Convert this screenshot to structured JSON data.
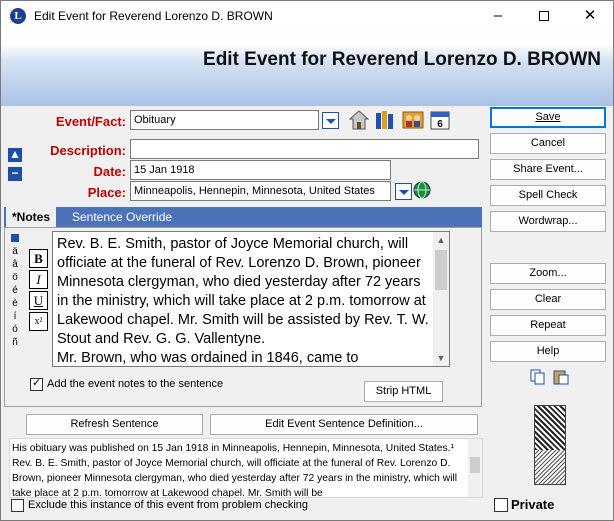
{
  "window": {
    "title": "Edit Event for Reverend Lorenzo D. BROWN",
    "app_icon": "L"
  },
  "header": {
    "title": "Edit Event for Reverend Lorenzo D. BROWN"
  },
  "form": {
    "event_fact": {
      "label": "Event/Fact:",
      "value": "Obituary"
    },
    "description": {
      "label": "Description:",
      "value": ""
    },
    "date": {
      "label": "Date:",
      "value": "15 Jan 1918"
    },
    "place": {
      "label": "Place:",
      "value": "Minneapolis, Hennepin, Minnesota, United States"
    }
  },
  "icons": {
    "house": "house-icon",
    "books": "books-icon",
    "people": "people-icon",
    "calendar": "calendar-icon",
    "calendar_text": "6",
    "globe": "globe-icon"
  },
  "tabs": [
    {
      "label": "*Notes"
    },
    {
      "label": "Sentence Override"
    }
  ],
  "special_chars": [
    "ä",
    "â",
    "ö",
    "é",
    "è",
    "í",
    "ó",
    "ñ"
  ],
  "format_buttons": {
    "bold": "B",
    "italic": "I",
    "underline": "U",
    "superscript": "x²"
  },
  "notes": {
    "text": "Rev. B. E. Smith, pastor of Joyce Memorial church, will officiate at the funeral of Rev. Lorenzo D. Brown, pioneer Minnesota clergyman, who died yesterday after 72 years in the ministry, which will take place at 2 p.m. tomorrow at Lakewood chapel.  Mr. Smith will be assisted by Rev. T. W. Stout and Rev. G. G. Vallentyne.\nMr. Brown, who was ordained in 1846, came to",
    "add_to_sentence_label": "Add the event notes to the sentence",
    "add_to_sentence_checked": true,
    "strip_html_label": "Strip HTML"
  },
  "sentence": {
    "refresh_label": "Refresh Sentence",
    "edit_definition_label": "Edit Event Sentence Definition...",
    "text": "His obituary was published on 15 Jan 1918 in Minneapolis, Hennepin, Minnesota, United States.¹ Rev. B. E. Smith, pastor of Joyce Memorial church, will officiate at the funeral of Rev. Lorenzo D. Brown, pioneer Minnesota clergyman, who died yesterday after 72 years in the ministry, which will take place at 2 p.m. tomorrow at Lakewood chapel.  Mr. Smith will be"
  },
  "exclude_label": "Exclude this instance of this event from problem checking",
  "private_label": "Private",
  "buttons": {
    "save": "Save",
    "cancel": "Cancel",
    "share_event": "Share Event...",
    "spell_check": "Spell Check",
    "wordwrap": "Wordwrap...",
    "zoom": "Zoom...",
    "clear": "Clear",
    "repeat": "Repeat",
    "help": "Help"
  },
  "nav": {
    "up": "▲",
    "down": "−"
  },
  "colors": {
    "label_red": "#c00000",
    "accent_blue": "#1e4fa8",
    "tab_bar": "#4c73b9"
  }
}
